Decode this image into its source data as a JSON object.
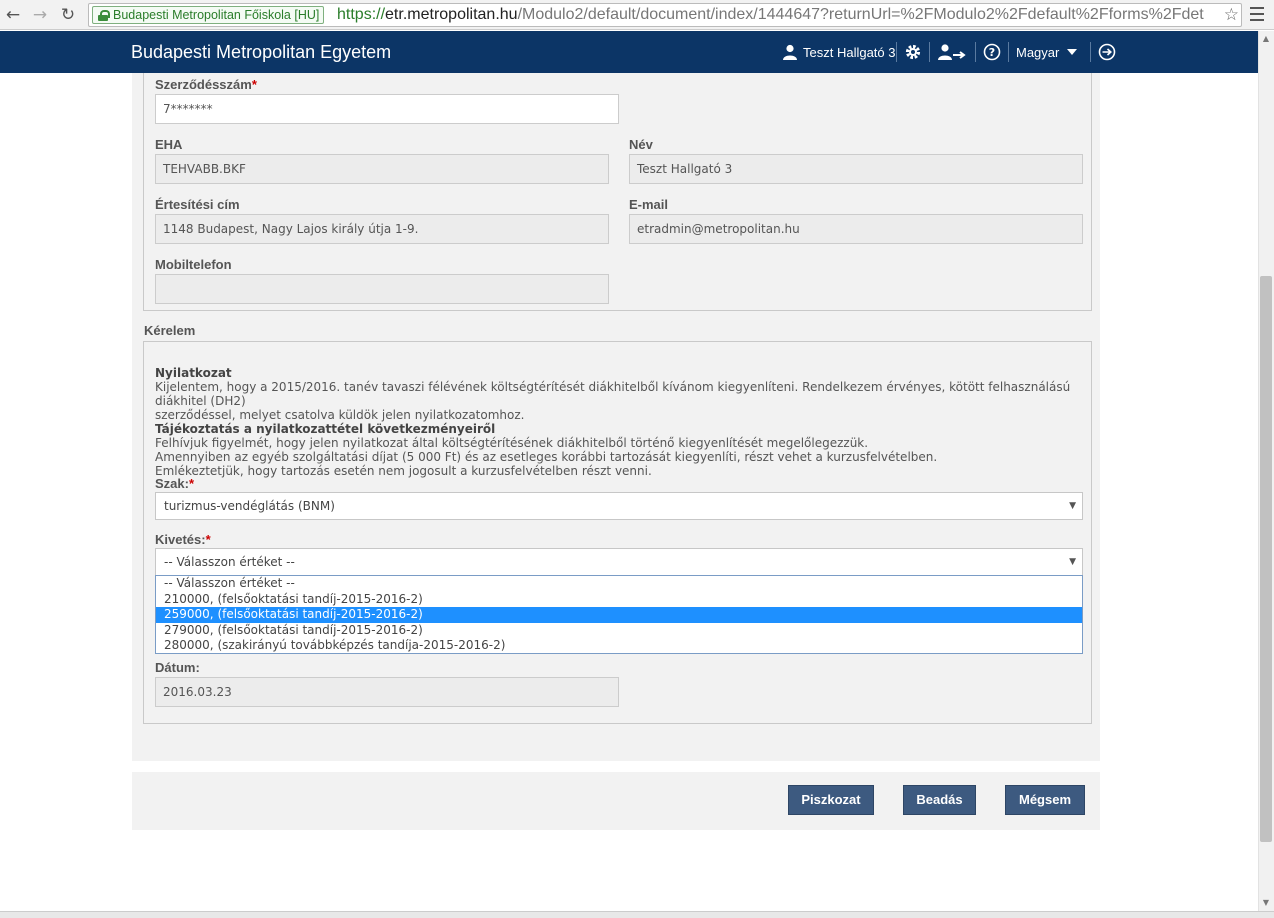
{
  "browser": {
    "secure_label": "Budapesti Metropolitan Főiskola [HU]",
    "url_scheme": "https://",
    "url_host": "etr.metropolitan.hu",
    "url_path": "/Modulo2/default/document/index/1444647?returnUrl=%2FModulo2%2Fdefault%2Fforms%2Fdet"
  },
  "header": {
    "brand": "Budapesti Metropolitan Egyetem",
    "user_name": "Teszt Hallgató 3",
    "language": "Magyar"
  },
  "personal": {
    "contract_label": "Szerződésszám",
    "contract_value": "7*******",
    "eha_label": "EHA",
    "eha_value": "TEHVABB.BKF",
    "name_label": "Név",
    "name_value": "Teszt Hallgató 3",
    "address_label": "Értesítési cím",
    "address_value": "1148 Budapest, Nagy Lajos király útja 1-9.",
    "email_label": "E-mail",
    "email_value": "etradmin@metropolitan.hu",
    "mobile_label": "Mobiltelefon",
    "mobile_value": ""
  },
  "request": {
    "section_title": "Kérelem",
    "decl_title": "Nyilatkozat",
    "decl_line1": "Kijelentem, hogy a 2015/2016. tanév tavaszi félévének költségtérítését diákhitelből kívánom kiegyenlíteni. Rendelkezem érvényes, kötött felhasználású diákhitel (DH2)",
    "decl_line2": "szerződéssel, melyet csatolva küldök jelen nyilatkozatomhoz.",
    "info_title": "Tájékoztatás a nyilatkozattétel következményeiről",
    "info_line1": "Felhívjuk figyelmét, hogy jelen nyilatkozat által költségtérítésének diákhitelből történő kiegyenlítését megelőlegezzük.",
    "info_line2": "Amennyiben az egyéb szolgáltatási díjat (5 000 Ft) és az esetleges korábbi tartozását kiegyenlíti, részt vehet a kurzusfelvételben.",
    "info_line3": "Emlékeztetjük, hogy tartozás esetén nem jogosult a kurzusfelvételben részt venni.",
    "szak_label": "Szak:",
    "szak_value": "turizmus-vendéglátás (BNM)",
    "kivetes_label": "Kivetés:",
    "kivetes_value": "-- Válasszon értéket --",
    "kivetes_options": [
      "-- Válasszon értéket --",
      "210000, (felsőoktatási tandíj-2015-2016-2)",
      "259000, (felsőoktatási tandíj-2015-2016-2)",
      "279000, (felsőoktatási tandíj-2015-2016-2)",
      "280000, (szakirányú továbbképzés tandíja-2015-2016-2)"
    ],
    "date_label": "Dátum:",
    "date_value": "2016.03.23"
  },
  "actions": {
    "draft": "Piszkozat",
    "submit": "Beadás",
    "cancel": "Mégsem"
  },
  "colors": {
    "header_bg": "#0c3566",
    "button_bg": "#3d5a80",
    "selected_option": "#1e90ff",
    "required": "#cc0000"
  }
}
